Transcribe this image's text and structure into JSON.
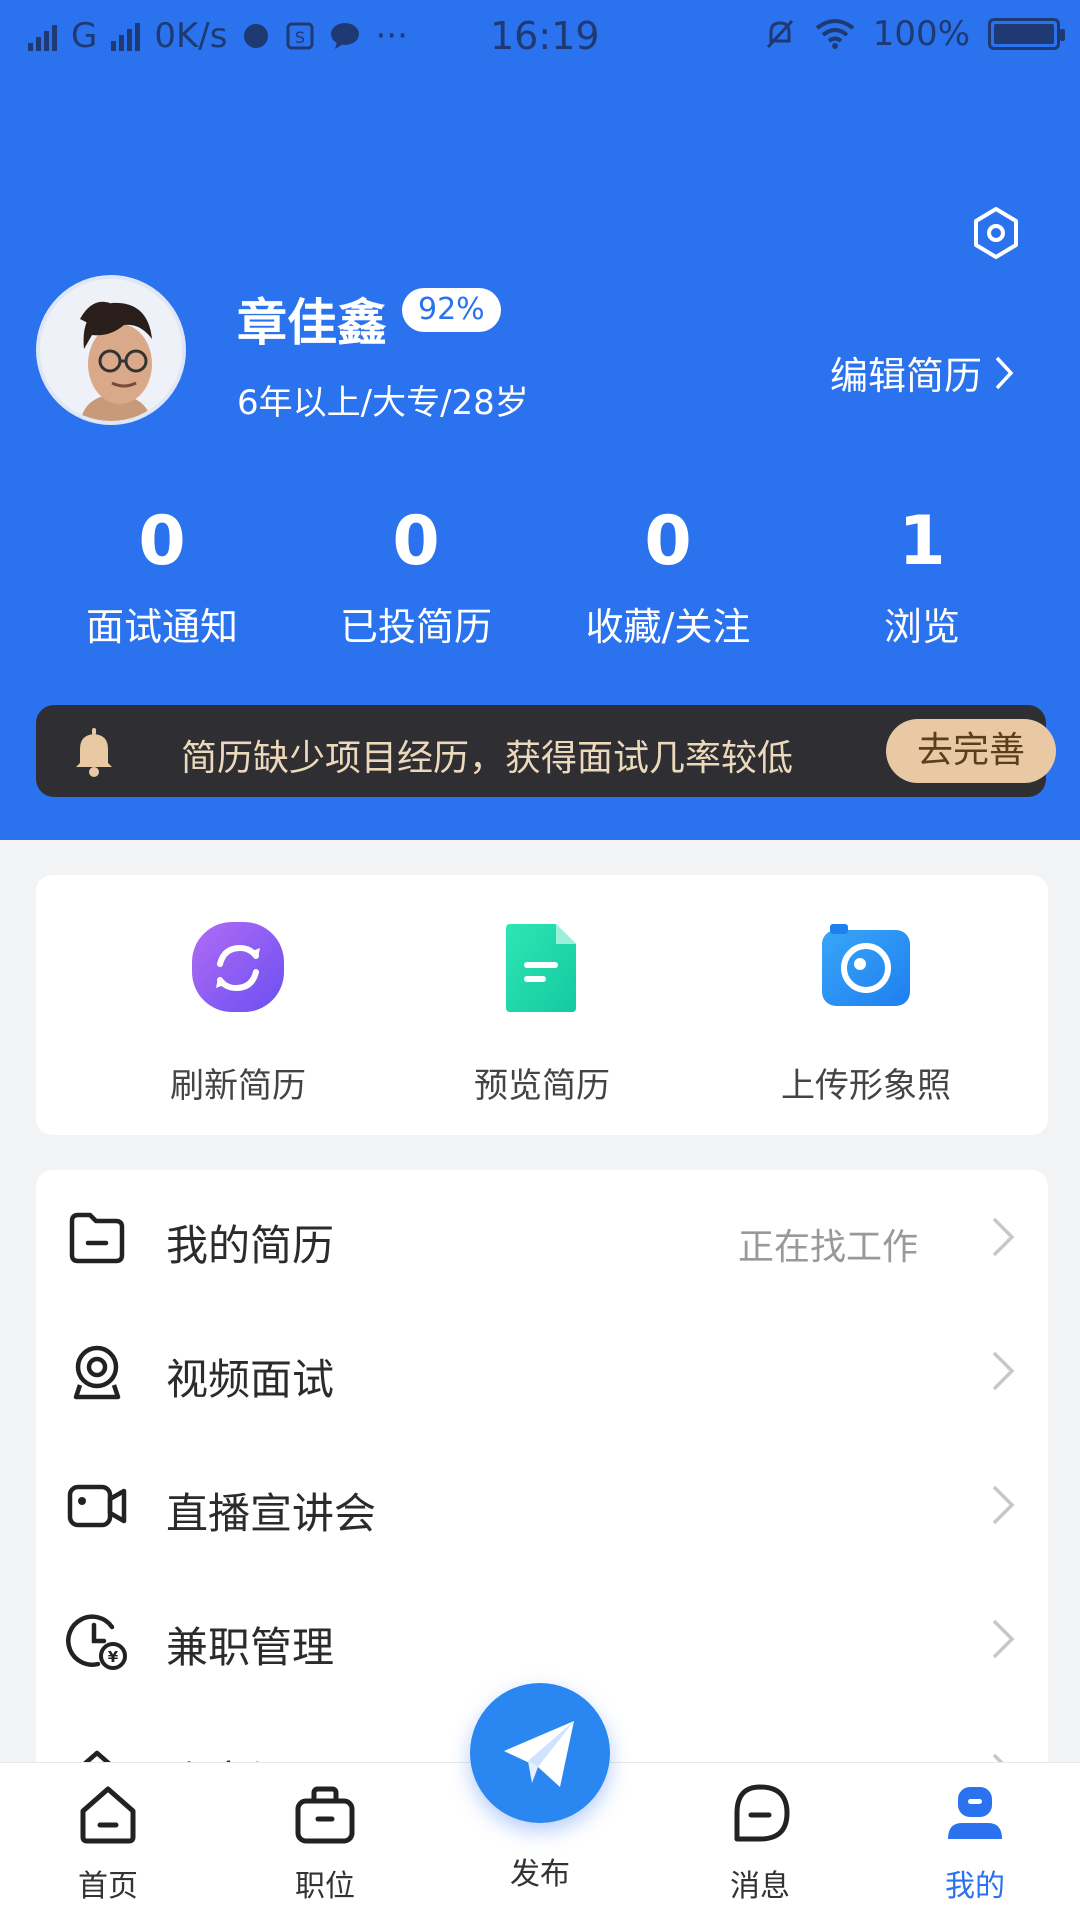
{
  "status_bar": {
    "network": "G",
    "speed": "0K/s",
    "time": "16:19",
    "battery": "100%",
    "battery_level": 1.0
  },
  "header": {
    "settings_icon": "hexagon-settings-icon",
    "user": {
      "name": "章佳鑫",
      "completion": "92%",
      "info": "6年以上/大专/28岁"
    },
    "edit_resume": "编辑简历"
  },
  "stats": [
    {
      "value": "0",
      "label": "面试通知"
    },
    {
      "value": "0",
      "label": "已投简历"
    },
    {
      "value": "0",
      "label": "收藏/关注"
    },
    {
      "value": "1",
      "label": "浏览"
    }
  ],
  "notice": {
    "text": "简历缺少项目经历，获得面试几率较低",
    "button": "去完善"
  },
  "quick_actions": [
    {
      "label": "刷新简历",
      "icon": "refresh-icon",
      "color": "#8a5cf0"
    },
    {
      "label": "预览简历",
      "icon": "document-icon",
      "color": "#1fd6a6"
    },
    {
      "label": "上传形象照",
      "icon": "camera-icon",
      "color": "#2a8ef0"
    }
  ],
  "menu": [
    {
      "label": "我的简历",
      "status": "正在找工作",
      "icon": "folder-icon"
    },
    {
      "label": "视频面试",
      "status": "",
      "icon": "webcam-icon"
    },
    {
      "label": "直播宣讲会",
      "status": "",
      "icon": "video-camera-icon"
    },
    {
      "label": "兼职管理",
      "status": "",
      "icon": "clock-yen-icon"
    },
    {
      "label": "账户设置",
      "status": "",
      "icon": "account-icon"
    }
  ],
  "tabbar": [
    {
      "label": "首页",
      "icon": "home-icon"
    },
    {
      "label": "职位",
      "icon": "briefcase-icon"
    },
    {
      "label": "发布",
      "icon": "paper-plane-icon"
    },
    {
      "label": "消息",
      "icon": "chat-icon"
    },
    {
      "label": "我的",
      "icon": "user-icon",
      "active": true
    }
  ],
  "colors": {
    "primary": "#2a72ee",
    "notice_bg": "#2f2f33",
    "notice_button": "#e8c9a4"
  }
}
